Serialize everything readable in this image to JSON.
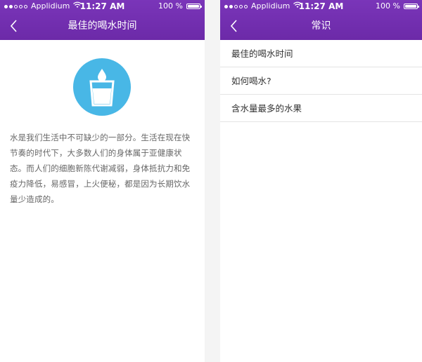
{
  "status": {
    "carrier": "Applidium",
    "time": "11:27 AM",
    "battery": "100 %"
  },
  "left_screen": {
    "title": "最佳的喝水时间",
    "back_icon": "chevron-left-icon",
    "hero_icon": "water-glass-icon",
    "body": "水是我们生活中不可缺少的一部分。生活在现在快节奏的时代下，大多数人们的身体属于亚健康状态。而人们的细胞新陈代谢减弱，身体抵抗力和免疫力降低，易感冒，上火便秘，都是因为长期饮水量少造成的。"
  },
  "right_screen": {
    "title": "常识",
    "back_icon": "chevron-left-icon",
    "items": [
      {
        "label": "最佳的喝水时间"
      },
      {
        "label": "如何喝水?"
      },
      {
        "label": "含水量最多的水果"
      }
    ]
  },
  "colors": {
    "accent": "#7030b0",
    "icon_bg": "#48b7e6"
  }
}
